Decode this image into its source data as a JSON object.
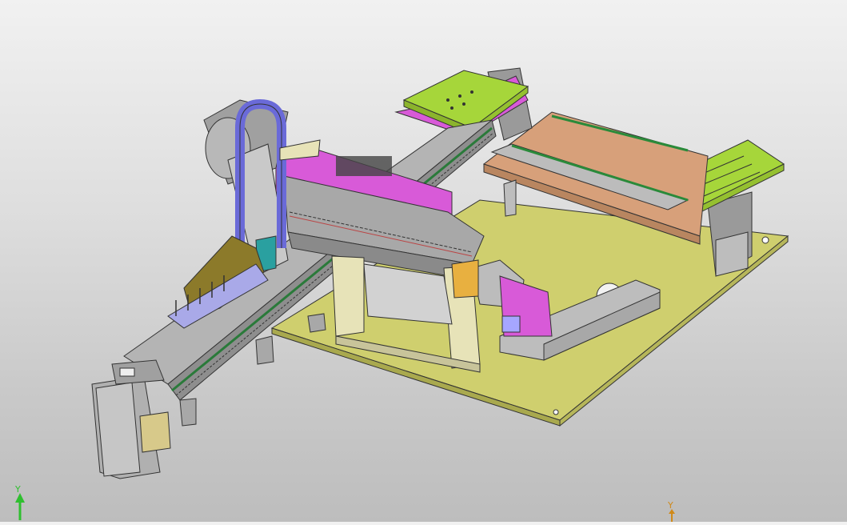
{
  "viewport": {
    "background": "#d8d8d8"
  },
  "triad_left": {
    "axis_label": "Y",
    "color": "#2fbf2f"
  },
  "triad_right": {
    "axis_label": "Y",
    "color": "#d08a1a"
  },
  "model_colors": {
    "base_plate": "#cfcf6e",
    "lime_fixture": "#a6d63a",
    "magenta_part": "#d85ad8",
    "blue_cable_carrier": "#6a6ad8",
    "copper_plate": "#d7a07a",
    "olive_bracket": "#8c7a2a",
    "gray_housing": "#9a9a9a"
  }
}
